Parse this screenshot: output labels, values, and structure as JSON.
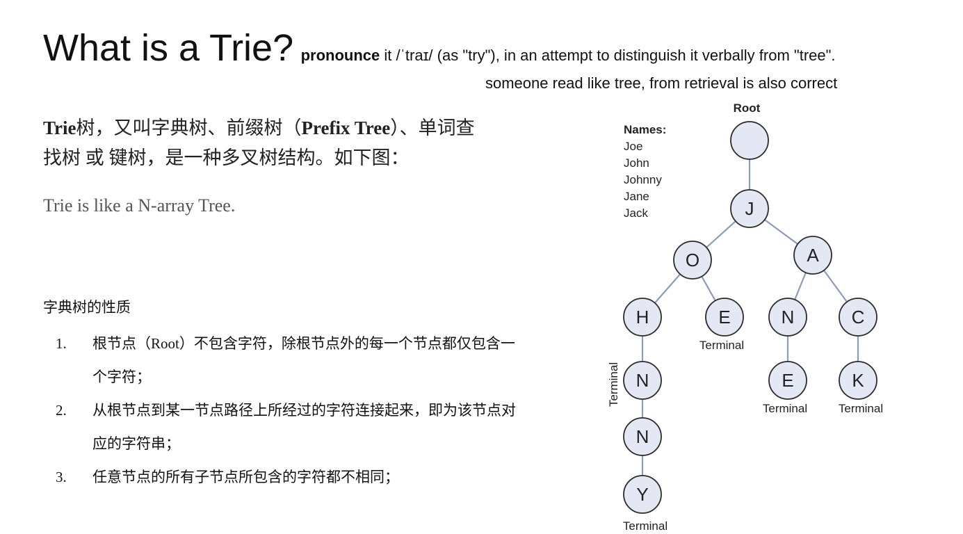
{
  "slide": {
    "title": "What is a Trie?",
    "pronounce_bold": "pronounce",
    "pronounce_rest": " it /ˈtraɪ/ (as \"try\"), in an attempt to distinguish it verbally from \"tree\".",
    "pronounce_note": "someone read like tree, from retrieval is also correct",
    "definition": {
      "s0": "Trie",
      "s1": "树，又叫字典树、前缀树（",
      "s2": "Prefix Tree",
      "s3": "）、单词查找树 或 键树，是一种多叉树结构。如下图："
    },
    "analogy": "Trie is like a N-array Tree.",
    "properties_heading": "字典树的性质",
    "properties": [
      {
        "num": "1.",
        "text": "根节点（Root）不包含字符，除根节点外的每一个节点都仅包含一个字符；"
      },
      {
        "num": "2.",
        "text": "从根节点到某一节点路径上所经过的字符连接起来，即为该节点对应的字符串；"
      },
      {
        "num": "3.",
        "text": "任意节点的所有子节点所包含的字符都不相同；"
      }
    ]
  },
  "diagram": {
    "root_label": "Root",
    "names_heading": "Names:",
    "names": [
      "Joe",
      "John",
      "Johnny",
      "Jane",
      "Jack"
    ],
    "nodes": {
      "j": "J",
      "o": "O",
      "a": "A",
      "h": "H",
      "e1": "E",
      "n1": "N",
      "c": "C",
      "n2": "N",
      "e2": "E",
      "k": "K",
      "n3": "N",
      "y": "Y"
    },
    "terminal_label": "Terminal",
    "colors": {
      "node_fill": "#e4e8f4",
      "node_stroke": "#2b2b2b",
      "edge": "#8b9bbb",
      "text": "#222222"
    }
  }
}
